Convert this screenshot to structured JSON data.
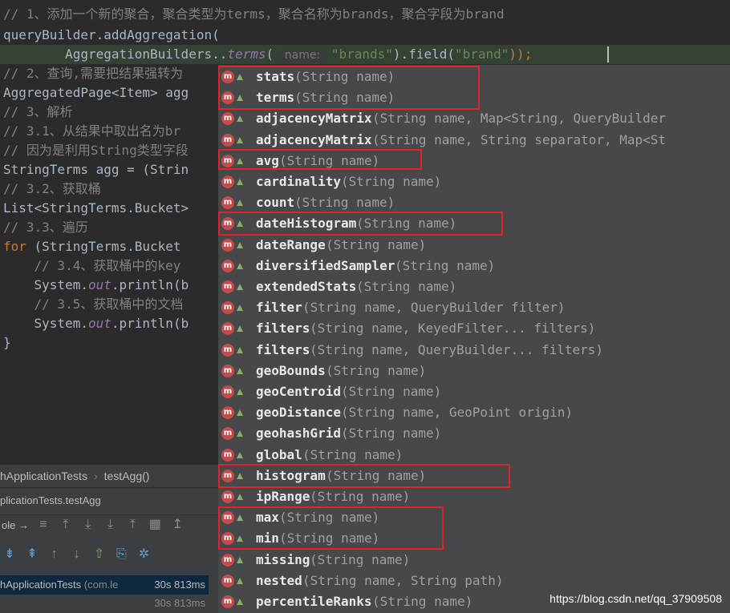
{
  "code": {
    "line1": "// 1、添加一个新的聚合，聚合类型为terms，聚合名称为brands，聚合字段为brand",
    "line2": "queryBuilder.addAggregation(",
    "line3_indent": "        ",
    "line3_prefix": "AggregationBuilders..",
    "line3_method": "terms",
    "line3_open": "( ",
    "line3_hint": "name:",
    "line3_space": " ",
    "line3_arg": "\"brands\"",
    "line3_mid": ").field(",
    "line3_arg2": "\"brand\"",
    "line3_end": "));",
    "line4": "// 2、查询,需要把结果强转为",
    "line5": "AggregatedPage<Item> agg",
    "line6": "// 3、解析",
    "line7": "// 3.1、从结果中取出名为br",
    "line8": "// 因为是利用String类型字段",
    "line9": "StringTerms agg = (Strin",
    "line10": "// 3.2、获取桶",
    "line11": "List<StringTerms.Bucket>",
    "line12": "// 3.3、遍历",
    "line13_kw": "for",
    "line13_rest": " (StringTerms.Bucket",
    "line14": "    // 3.4、获取桶中的key",
    "line15_a": "    System.",
    "line15_b": "out",
    "line15_c": ".println(b",
    "line16": "    // 3.5、获取桶中的文档",
    "line17_a": "    System.",
    "line17_b": "out",
    "line17_c": ".println(b",
    "line18": "}"
  },
  "bottom_panel": {
    "breadcrumb_class": "hApplicationTests",
    "breadcrumb_method": "testAgg()",
    "run_tab": "plicationTests.testAgg",
    "console_label": "ole",
    "tree_item_name": "hApplicationTests",
    "tree_item_pkg": "(com.le",
    "tree_item_time": "30s 813ms",
    "tree_item2_time": "30s 813ms"
  },
  "completion": {
    "icon_letter": "m",
    "items": [
      {
        "name": "stats",
        "sig": "(String name)"
      },
      {
        "name": "terms",
        "sig": "(String name)"
      },
      {
        "name": "adjacencyMatrix",
        "sig": "(String name, Map<String, QueryBuilder"
      },
      {
        "name": "adjacencyMatrix",
        "sig": "(String name, String separator, Map<St"
      },
      {
        "name": "avg",
        "sig": "(String name)"
      },
      {
        "name": "cardinality",
        "sig": "(String name)"
      },
      {
        "name": "count",
        "sig": "(String name)"
      },
      {
        "name": "dateHistogram",
        "sig": "(String name)"
      },
      {
        "name": "dateRange",
        "sig": "(String name)"
      },
      {
        "name": "diversifiedSampler",
        "sig": "(String name)"
      },
      {
        "name": "extendedStats",
        "sig": "(String name)"
      },
      {
        "name": "filter",
        "sig": "(String name, QueryBuilder filter)"
      },
      {
        "name": "filters",
        "sig": "(String name, KeyedFilter... filters)"
      },
      {
        "name": "filters",
        "sig": "(String name, QueryBuilder... filters)"
      },
      {
        "name": "geoBounds",
        "sig": "(String name)"
      },
      {
        "name": "geoCentroid",
        "sig": "(String name)"
      },
      {
        "name": "geoDistance",
        "sig": "(String name, GeoPoint origin)"
      },
      {
        "name": "geohashGrid",
        "sig": "(String name)"
      },
      {
        "name": "global",
        "sig": "(String name)"
      },
      {
        "name": "histogram",
        "sig": "(String name)"
      },
      {
        "name": "ipRange",
        "sig": "(String name)"
      },
      {
        "name": "max",
        "sig": "(String name)"
      },
      {
        "name": "min",
        "sig": "(String name)"
      },
      {
        "name": "missing",
        "sig": "(String name)"
      },
      {
        "name": "nested",
        "sig": "(String name, String path)"
      },
      {
        "name": "percentileRanks",
        "sig": "(String name)"
      }
    ]
  },
  "watermark": "https://blog.csdn.net/qq_37909508",
  "colors": {
    "highlight_box": "#e0242b",
    "method_icon": "#c44b4b",
    "popup_bg": "#46484a",
    "editor_bg": "#2b2b2b"
  }
}
